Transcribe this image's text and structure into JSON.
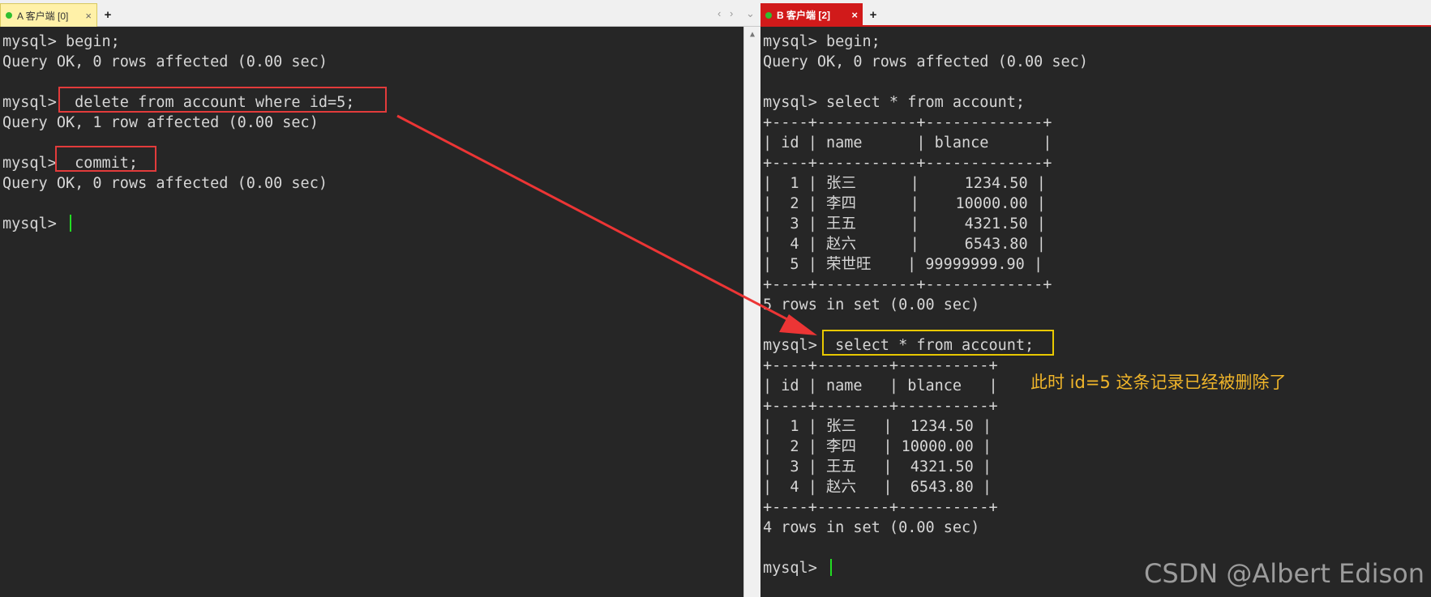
{
  "left_tab": {
    "label": "A 客户端 [0]",
    "close": "×",
    "new_tab": "+"
  },
  "right_tab": {
    "label": "B 客户端 [2]",
    "close": "×",
    "new_tab": "+"
  },
  "tab_nav": {
    "prev": "‹",
    "next": "›",
    "menu": "⌄"
  },
  "scrollbar": {
    "up": "▲"
  },
  "left_terminal": {
    "lines": [
      "mysql> begin;",
      "Query OK, 0 rows affected (0.00 sec)",
      "",
      "mysql>  delete from account where id=5;",
      "Query OK, 1 row affected (0.00 sec)",
      "",
      "mysql>  commit;",
      "Query OK, 0 rows affected (0.00 sec)",
      "",
      "mysql> "
    ]
  },
  "right_terminal": {
    "lines": [
      "mysql> begin;",
      "Query OK, 0 rows affected (0.00 sec)",
      "",
      "mysql> select * from account;",
      "+----+-----------+-------------+",
      "| id | name      | blance      |",
      "+----+-----------+-------------+",
      "|  1 | 张三      |     1234.50 |",
      "|  2 | 李四      |    10000.00 |",
      "|  3 | 王五      |     4321.50 |",
      "|  4 | 赵六      |     6543.80 |",
      "|  5 | 荣世旺    | 99999999.90 |",
      "+----+-----------+-------------+",
      "5 rows in set (0.00 sec)",
      "",
      "mysql>  select * from account;",
      "+----+--------+----------+",
      "| id | name   | blance   |",
      "+----+--------+----------+",
      "|  1 | 张三   |  1234.50 |",
      "|  2 | 李四   | 10000.00 |",
      "|  3 | 王五   |  4321.50 |",
      "|  4 | 赵六   |  6543.80 |",
      "+----+--------+----------+",
      "4 rows in set (0.00 sec)",
      "",
      "mysql> "
    ]
  },
  "annotation": "此时 id=5 这条记录已经被删除了",
  "watermark": "CSDN @Albert Edison",
  "colors": {
    "highlight_red": "#e23b3b",
    "highlight_yellow": "#e8c800",
    "arrow": "#ec3535",
    "cursor": "#22dd22"
  }
}
